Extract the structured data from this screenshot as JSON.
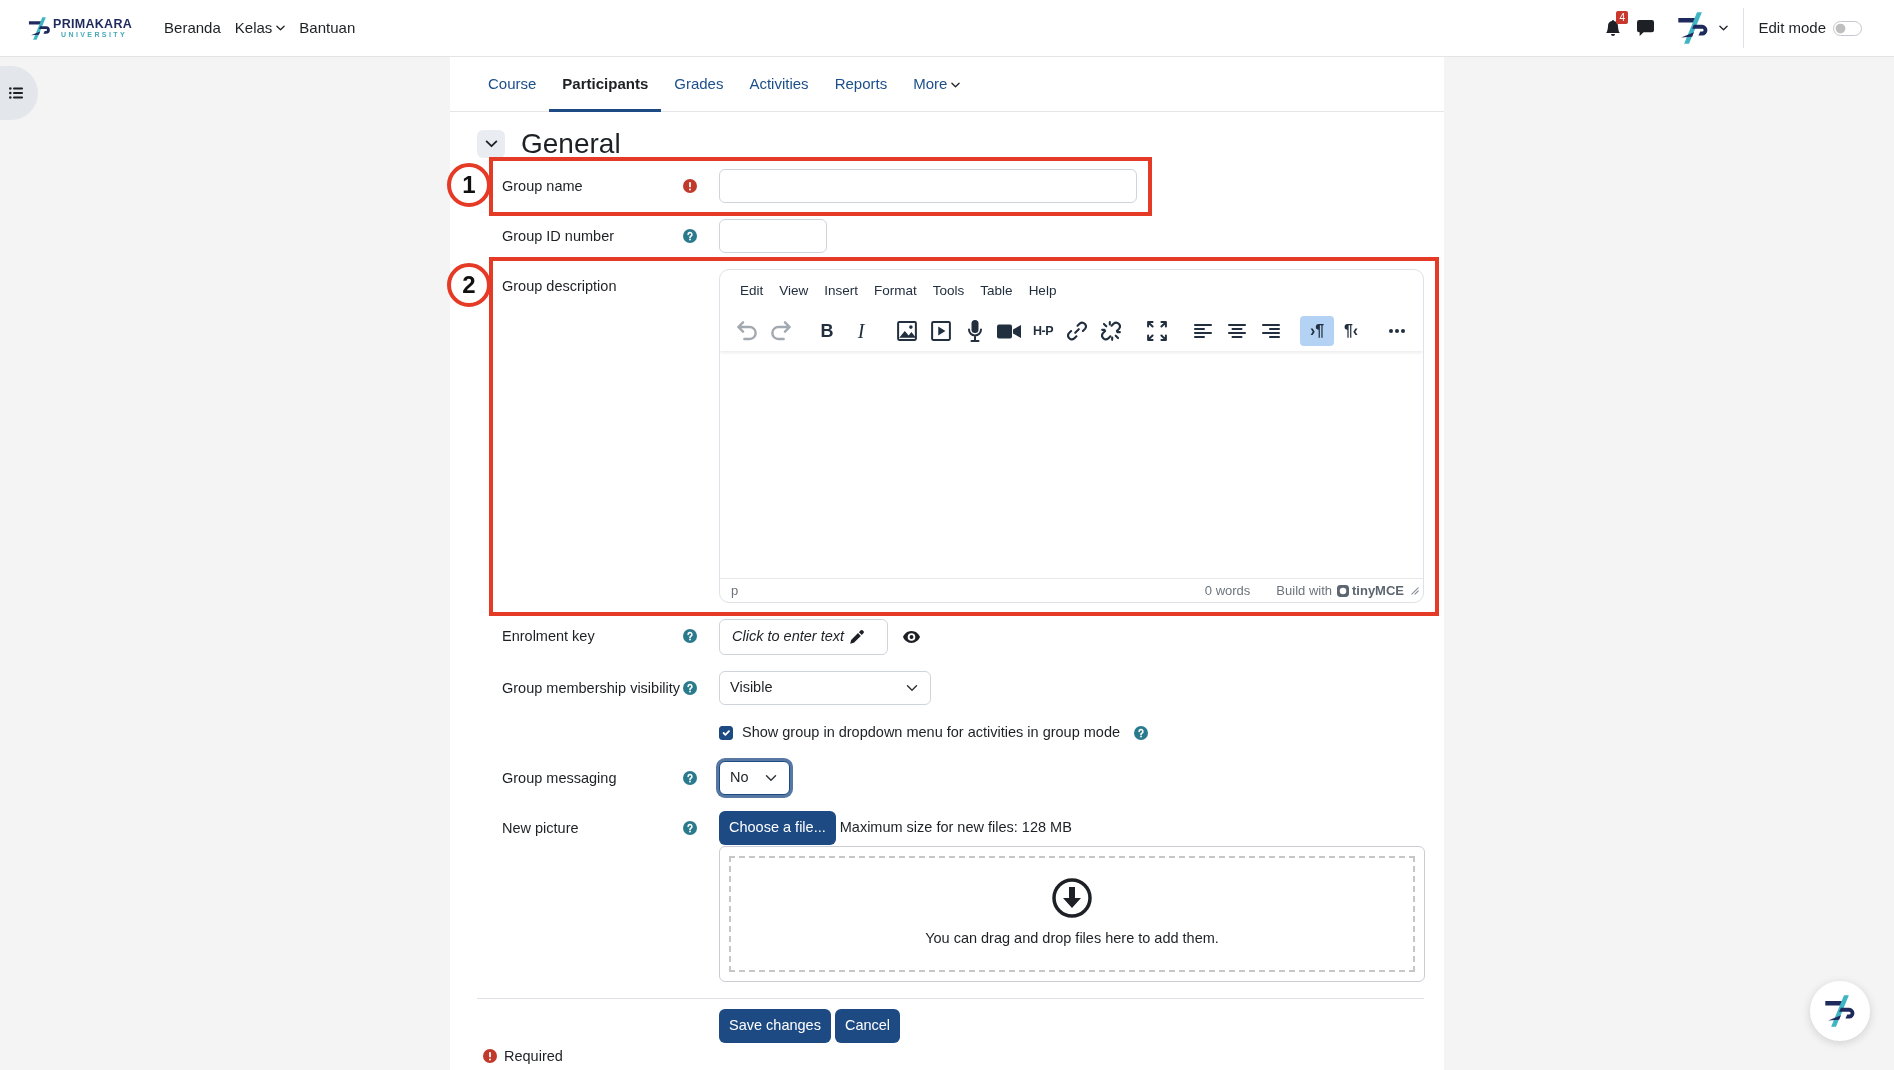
{
  "navbar": {
    "brand": {
      "name": "PRIMAKARA",
      "tagline": "UNIVERSITY"
    },
    "links": [
      {
        "label": "Beranda",
        "dropdown": false
      },
      {
        "label": "Kelas",
        "dropdown": true
      },
      {
        "label": "Bantuan",
        "dropdown": false
      }
    ],
    "notifications": {
      "count": "4"
    },
    "edit_mode": {
      "label": "Edit mode",
      "on": false
    }
  },
  "tabs": [
    {
      "label": "Course",
      "selected": false,
      "dropdown": false
    },
    {
      "label": "Participants",
      "selected": true,
      "dropdown": false
    },
    {
      "label": "Grades",
      "selected": false,
      "dropdown": false
    },
    {
      "label": "Activities",
      "selected": false,
      "dropdown": false
    },
    {
      "label": "Reports",
      "selected": false,
      "dropdown": false
    },
    {
      "label": "More",
      "selected": false,
      "dropdown": true
    }
  ],
  "section": {
    "title": "General",
    "expanded": true
  },
  "fields": [
    {
      "kind": "text",
      "label": "Group name",
      "required": true,
      "help": false,
      "annotation": "1"
    },
    {
      "kind": "text",
      "label": "Group ID number",
      "required": false,
      "help": true
    },
    {
      "kind": "editor",
      "label": "Group description",
      "required": false,
      "help": false,
      "annotation": "2",
      "menubar": [
        "Edit",
        "View",
        "Insert",
        "Format",
        "Tools",
        "Table",
        "Help"
      ],
      "toolbar": [
        {
          "tools": [
            {
              "kind": "undo",
              "disabled": true,
              "active": false
            },
            {
              "kind": "redo",
              "disabled": true,
              "active": false
            }
          ]
        },
        {
          "tools": [
            {
              "kind": "bold",
              "label": "B",
              "disabled": false,
              "active": false
            },
            {
              "kind": "italic",
              "label": "I",
              "disabled": false,
              "active": false
            }
          ]
        },
        {
          "tools": [
            {
              "kind": "image",
              "disabled": false,
              "active": false
            },
            {
              "kind": "media",
              "disabled": false,
              "active": false
            },
            {
              "kind": "microphone",
              "disabled": false,
              "active": false
            },
            {
              "kind": "camera",
              "disabled": false,
              "active": false
            },
            {
              "kind": "plugin",
              "label": "H-P",
              "disabled": false,
              "active": false
            },
            {
              "kind": "link",
              "disabled": false,
              "active": false
            },
            {
              "kind": "unlink",
              "disabled": false,
              "active": false
            }
          ]
        },
        {
          "tools": [
            {
              "kind": "fullscreen",
              "disabled": false,
              "active": false
            }
          ]
        },
        {
          "tools": [
            {
              "kind": "alignleft",
              "disabled": false,
              "active": false
            },
            {
              "kind": "aligncenter",
              "disabled": false,
              "active": false
            },
            {
              "kind": "alignright",
              "disabled": false,
              "active": false
            }
          ]
        },
        {
          "tools": [
            {
              "kind": "ltr",
              "label": "›¶",
              "disabled": false,
              "active": true
            },
            {
              "kind": "rtl",
              "label": "¶‹",
              "disabled": false,
              "active": false
            }
          ]
        },
        {
          "tools": [
            {
              "kind": "more",
              "disabled": false,
              "active": false
            }
          ]
        }
      ],
      "path": "p",
      "word_count": "0 words",
      "branding_prefix": "Build with",
      "branding": "tinyMCE"
    },
    {
      "kind": "inplace",
      "label": "Enrolment key",
      "required": false,
      "help": true,
      "prompt": "Click to enter text"
    },
    {
      "kind": "select",
      "label": "Group membership visibility",
      "required": false,
      "help": true,
      "value": "Visible",
      "focused": false
    },
    {
      "kind": "checkbox",
      "text": "Show group in dropdown menu for activities in group mode",
      "checked": true,
      "required": false,
      "help": true
    },
    {
      "kind": "select",
      "label": "Group messaging",
      "required": false,
      "help": true,
      "value": "No",
      "focused": true
    },
    {
      "kind": "filepicker",
      "label": "New picture",
      "required": false,
      "help": true,
      "button": "Choose a file...",
      "limit": "Maximum size for new files: 128 MB",
      "drop_text": "You can drag and drop files here to add them."
    }
  ],
  "buttons": [
    {
      "label": "Save changes"
    },
    {
      "label": "Cancel"
    }
  ],
  "required_note": {
    "text": "Required"
  }
}
